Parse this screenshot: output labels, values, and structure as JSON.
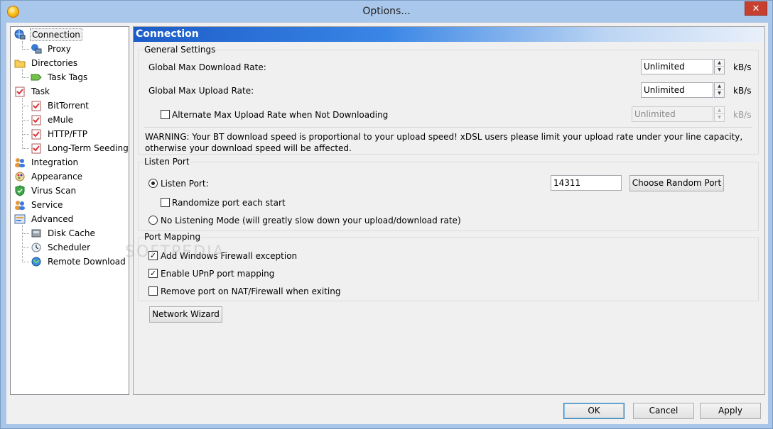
{
  "window": {
    "title": "Options...",
    "close_symbol": "✕"
  },
  "tree": {
    "items": [
      {
        "label": "Connection",
        "icon": "globe-network-icon",
        "selected": true
      },
      {
        "label": "Proxy",
        "icon": "proxy-network-icon"
      },
      {
        "label": "Directories",
        "icon": "folder-icon"
      },
      {
        "label": "Task Tags",
        "icon": "tag-icon"
      },
      {
        "label": "Task",
        "icon": "task-clipboard-icon"
      },
      {
        "label": "BitTorrent",
        "icon": "task-clipboard-icon"
      },
      {
        "label": "eMule",
        "icon": "task-clipboard-icon"
      },
      {
        "label": "HTTP/FTP",
        "icon": "task-clipboard-icon"
      },
      {
        "label": "Long-Term Seeding",
        "icon": "task-clipboard-icon"
      },
      {
        "label": "Integration",
        "icon": "users-icon"
      },
      {
        "label": "Appearance",
        "icon": "palette-icon"
      },
      {
        "label": "Virus Scan",
        "icon": "shield-icon"
      },
      {
        "label": "Service",
        "icon": "users-icon"
      },
      {
        "label": "Advanced",
        "icon": "advanced-icon"
      },
      {
        "label": "Disk Cache",
        "icon": "disk-icon"
      },
      {
        "label": "Scheduler",
        "icon": "scheduler-icon"
      },
      {
        "label": "Remote Download",
        "icon": "globe-icon"
      }
    ]
  },
  "panel": {
    "header": "Connection",
    "general": {
      "title": "General Settings",
      "download_label": "Global Max Download Rate:",
      "download_value": "Unlimited",
      "upload_label": "Global Max Upload Rate:",
      "upload_value": "Unlimited",
      "alt_label": "Alternate Max Upload Rate when Not Downloading",
      "alt_checked": false,
      "alt_value": "Unlimited",
      "unit": "kB/s",
      "warning": "WARNING: Your BT download speed is proportional to your upload speed! xDSL users please limit your upload rate under your line capacity, otherwise your download speed will be affected."
    },
    "listen": {
      "title": "Listen Port",
      "port_label": "Listen Port:",
      "port_value": "14311",
      "random_button": "Choose Random Port",
      "randomize_label": "Randomize port each start",
      "no_listen_label": "No Listening Mode (will greatly slow down your upload/download rate)"
    },
    "mapping": {
      "title": "Port Mapping",
      "firewall_label": "Add Windows Firewall exception",
      "firewall_checked": true,
      "upnp_label": "Enable UPnP port mapping",
      "upnp_checked": true,
      "remove_label": "Remove port on NAT/Firewall when exiting",
      "remove_checked": false
    },
    "wizard_button": "Network Wizard"
  },
  "footer": {
    "ok": "OK",
    "cancel": "Cancel",
    "apply": "Apply"
  },
  "watermark": "SOFTPEDIA",
  "colors": {
    "header_start": "#1c5cc8",
    "header_end": "#e9f0fa",
    "frame": "#a9c6e8"
  }
}
